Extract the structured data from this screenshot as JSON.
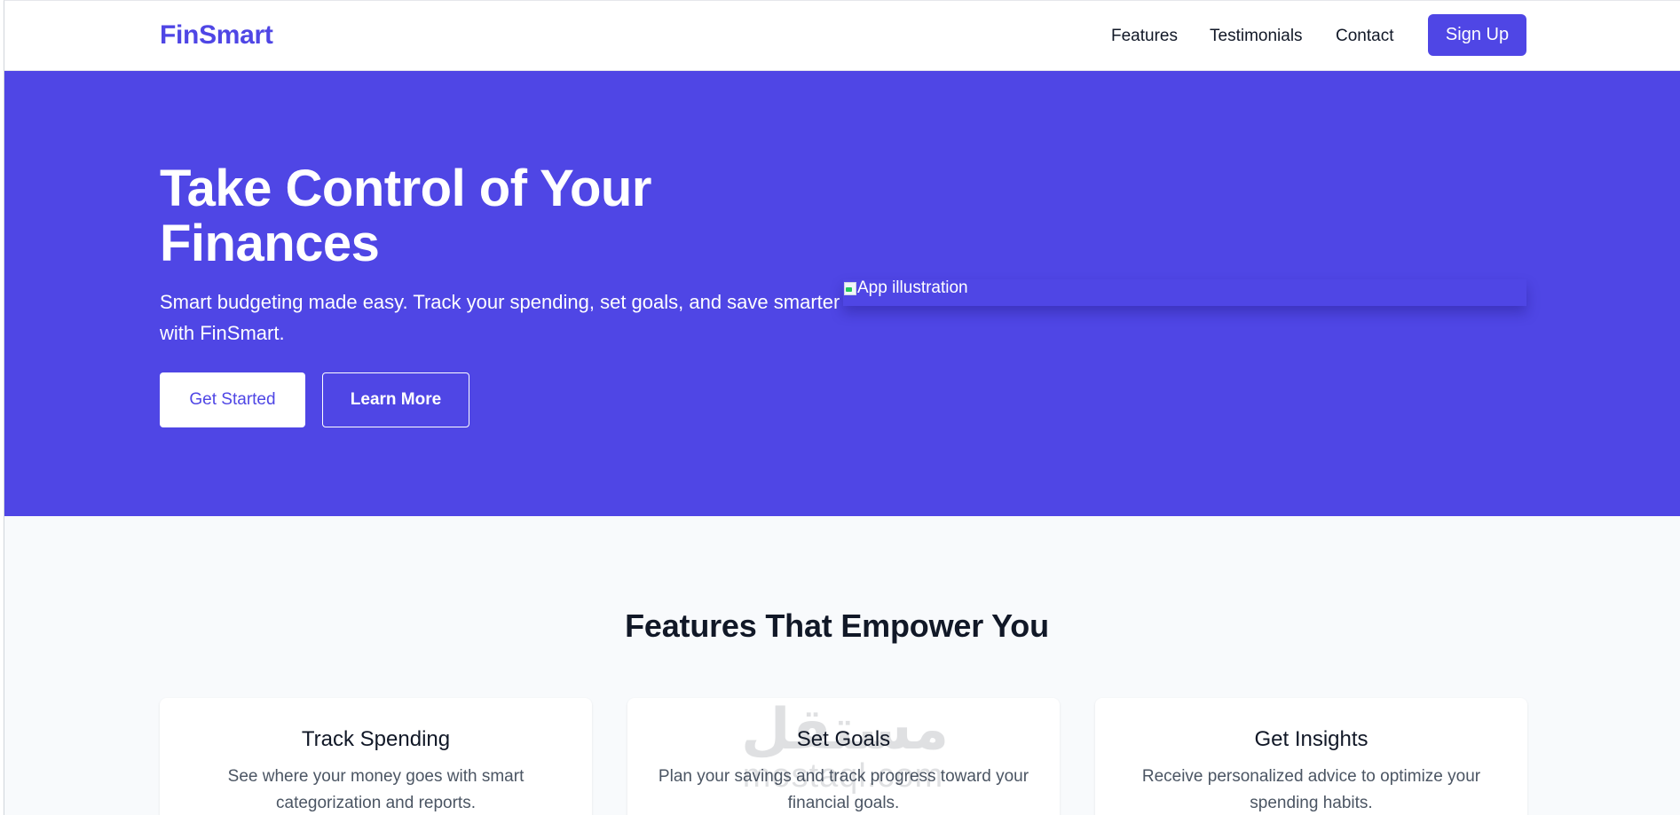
{
  "navbar": {
    "logo": "FinSmart",
    "links": [
      "Features",
      "Testimonials",
      "Contact"
    ],
    "signup_label": "Sign Up"
  },
  "hero": {
    "title": "Take Control of Your Finances",
    "subtitle": "Smart budgeting made easy. Track your spending, set goals, and save smarter with FinSmart.",
    "primary_button": "Get Started",
    "secondary_button": "Learn More",
    "illustration_alt": "App illustration"
  },
  "features": {
    "heading": "Features That Empower You",
    "cards": [
      {
        "title": "Track Spending",
        "text": "See where your money goes with smart categorization and reports."
      },
      {
        "title": "Set Goals",
        "text": "Plan your savings and track progress toward your financial goals."
      },
      {
        "title": "Get Insights",
        "text": "Receive personalized advice to optimize your spending habits."
      }
    ]
  },
  "watermark": {
    "arabic": "مستقل",
    "latin": "mostaql.com"
  },
  "colors": {
    "brand": "#4f46e5",
    "hero_bg": "#4f46e5",
    "section_bg": "#f8fafc",
    "text_dark": "#111827"
  }
}
